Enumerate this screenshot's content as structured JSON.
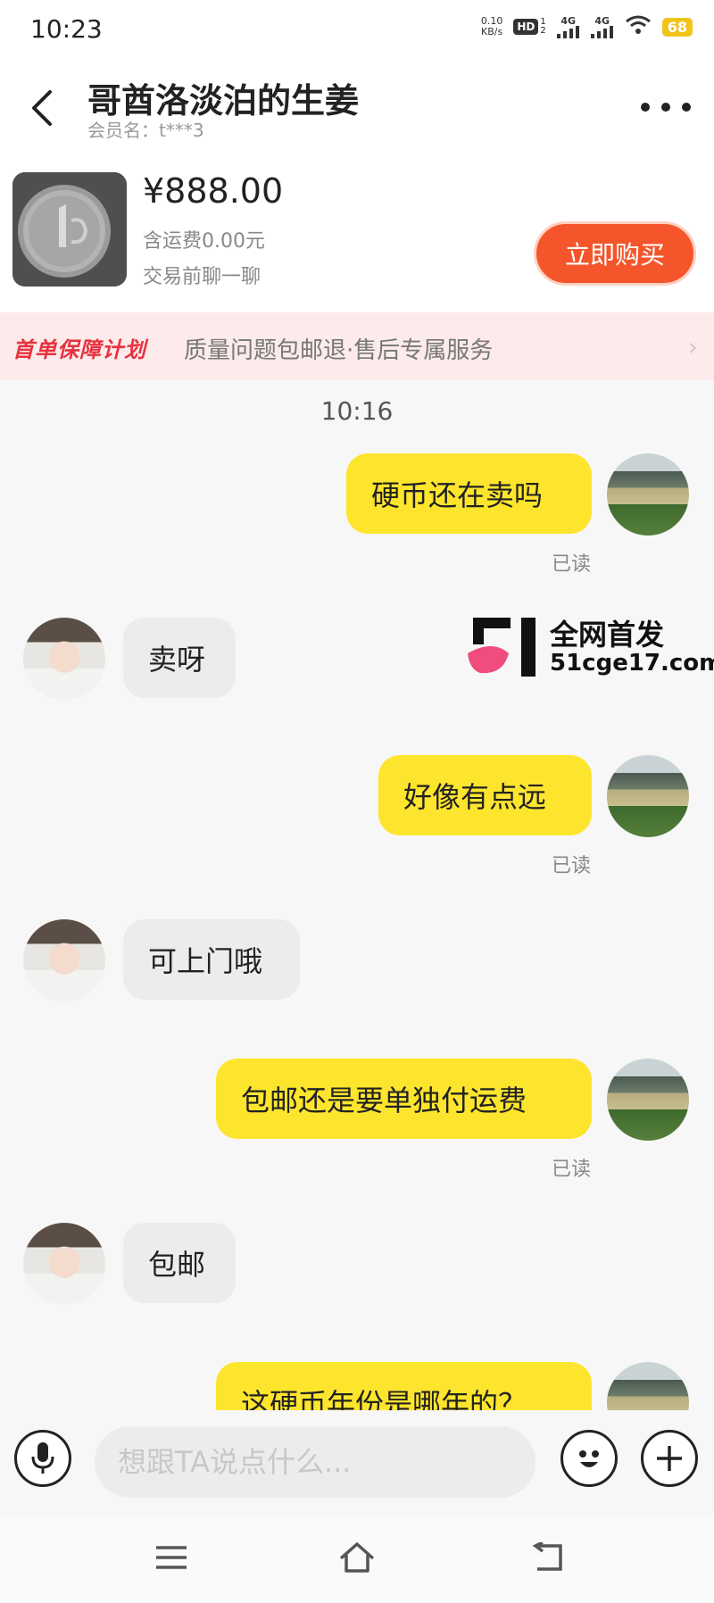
{
  "status_bar": {
    "time": "10:23",
    "net_speed_value": "0.10",
    "net_speed_unit": "KB/s",
    "hd_label": "HD",
    "sim1_label": "1",
    "sim2_label": "2",
    "signal1_label": "4G",
    "signal2_label": "4G",
    "battery": "68"
  },
  "header": {
    "title": "哥酋洛淡泊的生姜",
    "member_label": "会员名：",
    "member_name": "t***3"
  },
  "product": {
    "price": "¥888.00",
    "shipping": "含运费0.00元",
    "note": "交易前聊一聊",
    "buy_label": "立即购买"
  },
  "banner": {
    "tag": "首单保障计划",
    "text": "质量问题包邮退·售后专属服务",
    "arrow": "›"
  },
  "chat": {
    "time": "10:16",
    "messages": [
      {
        "from": "me",
        "text": "硬币还在卖吗",
        "status": "已读"
      },
      {
        "from": "other",
        "text": "卖呀"
      },
      {
        "from": "me",
        "text": "好像有点远",
        "status": "已读"
      },
      {
        "from": "other",
        "text": "可上门哦"
      },
      {
        "from": "me",
        "text": "包邮还是要单独付运费",
        "status": "已读"
      },
      {
        "from": "other",
        "text": "包邮"
      },
      {
        "from": "me",
        "text": "这硬币年份是哪年的？"
      }
    ]
  },
  "watermark": {
    "line1": "全网首发",
    "line2": "51cge17.com"
  },
  "input": {
    "placeholder": "想跟TA说点什么..."
  },
  "colors": {
    "accent": "#f4552a",
    "my_bubble": "#fde52e",
    "other_bubble": "#ececec",
    "banner_tag": "#e7333f"
  }
}
